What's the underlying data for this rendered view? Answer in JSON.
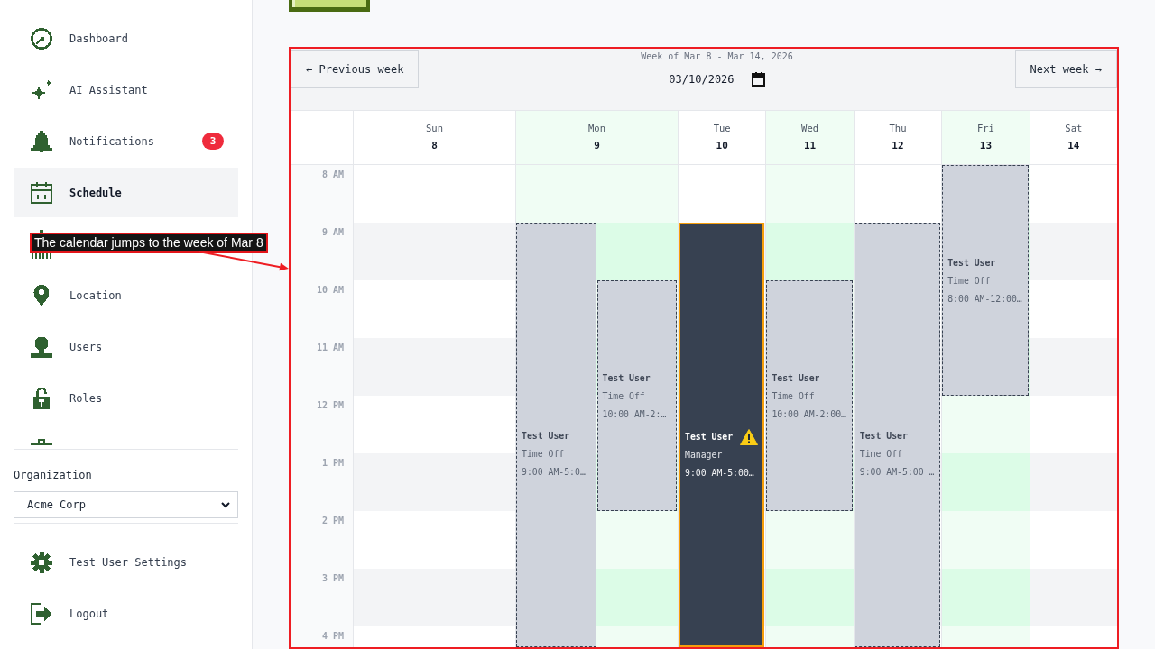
{
  "sidebar": {
    "nav": [
      {
        "label": "Dashboard",
        "selected": false
      },
      {
        "label": "AI Assistant",
        "selected": false
      },
      {
        "label": "Notifications",
        "badge": "3",
        "selected": false
      },
      {
        "label": "Schedule",
        "selected": true
      },
      {
        "selected": false
      },
      {
        "label": "Location",
        "selected": false
      },
      {
        "label": "Users",
        "selected": false
      },
      {
        "label": "Roles",
        "selected": false
      },
      {
        "selected": false
      }
    ],
    "organization": {
      "label": "Organization",
      "value": "Acme Corp"
    },
    "account": [
      {
        "label": "Test User Settings"
      },
      {
        "label": "Logout"
      }
    ]
  },
  "calendar": {
    "prev_button": "← Previous week",
    "next_button": "Next week →",
    "week_title": "Week of Mar 8 - Mar 14, 2026",
    "date": "03/10/2026",
    "times": [
      "8 AM",
      "9 AM",
      "10 AM",
      "11 AM",
      "12 PM",
      "1 PM",
      "2 PM",
      "3 PM",
      "4 PM"
    ],
    "days": [
      {
        "name": "Sun",
        "date": "8",
        "available": false
      },
      {
        "name": "Mon",
        "date": "9",
        "available": true,
        "events": [
          {
            "kind": "time-off",
            "title": "Test User",
            "subtitle": "Time Off",
            "time": "9:00 AM-5:0…",
            "warning": false
          },
          {
            "kind": "time-off",
            "title": "Test User",
            "subtitle": "Time Off",
            "time": "10:00 AM-2:…",
            "warning": false
          }
        ]
      },
      {
        "name": "Tue",
        "date": "10",
        "available": false,
        "events": [
          {
            "kind": "shift",
            "title": "Test User",
            "subtitle": "Manager",
            "time": "9:00 AM-5:00…",
            "warning": true
          }
        ]
      },
      {
        "name": "Wed",
        "date": "11",
        "available": true,
        "events": [
          {
            "kind": "time-off",
            "title": "Test User",
            "subtitle": "Time Off",
            "time": "10:00 AM-2:00…",
            "warning": false
          }
        ]
      },
      {
        "name": "Thu",
        "date": "12",
        "available": false,
        "events": [
          {
            "kind": "time-off",
            "title": "Test User",
            "subtitle": "Time Off",
            "time": "9:00 AM-5:00 …",
            "warning": false
          }
        ]
      },
      {
        "name": "Fri",
        "date": "13",
        "available": true,
        "events": [
          {
            "kind": "time-off",
            "title": "Test User",
            "subtitle": "Time Off",
            "time": "8:00 AM-12:00…",
            "warning": false
          }
        ]
      },
      {
        "name": "Sat",
        "date": "14",
        "available": false
      }
    ]
  },
  "annotation": {
    "text": "The calendar jumps to the week of Mar 8"
  }
}
